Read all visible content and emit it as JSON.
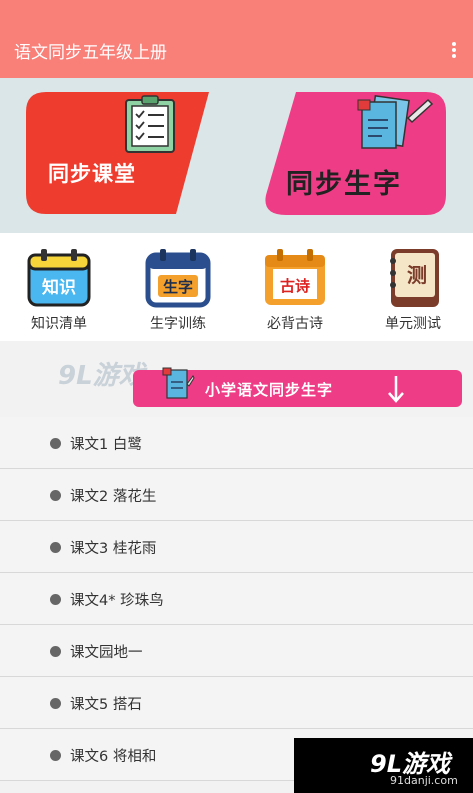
{
  "appbar": {
    "title": "语文同步五年级上册",
    "menu_icon": "more-vert-icon"
  },
  "cards": {
    "left": {
      "label": "同步课堂",
      "color": "#ee3d2f",
      "icon": "clipboard-checklist-icon"
    },
    "right": {
      "label": "同步生字",
      "color": "#ee3d86",
      "icon": "books-pencil-icon"
    }
  },
  "quick": [
    {
      "label": "知识清单",
      "icon_text": "知识",
      "icon": "calendar-knowledge-icon",
      "color": "#4ab7f0"
    },
    {
      "label": "生字训练",
      "icon_text": "生字",
      "icon": "calendar-characters-icon",
      "color": "#2b4f8e"
    },
    {
      "label": "必背古诗",
      "icon_text": "古诗",
      "icon": "calendar-poem-icon",
      "color": "#f3a02c"
    },
    {
      "label": "单元测试",
      "icon_text": "测",
      "icon": "notebook-test-icon",
      "color": "#7b3d2a"
    }
  ],
  "watermark": "9L游戏",
  "section_pill": {
    "label": "小学语文同步生字",
    "arrow": "arrow-down-icon"
  },
  "lessons": [
    "课文1 白鹭",
    "课文2 落花生",
    "课文3 桂花雨",
    "课文4* 珍珠鸟",
    "课文园地一",
    "课文5 搭石",
    "课文6 将相和"
  ],
  "corner_logo": {
    "logo": "9L游戏",
    "site": "91danji.com"
  }
}
